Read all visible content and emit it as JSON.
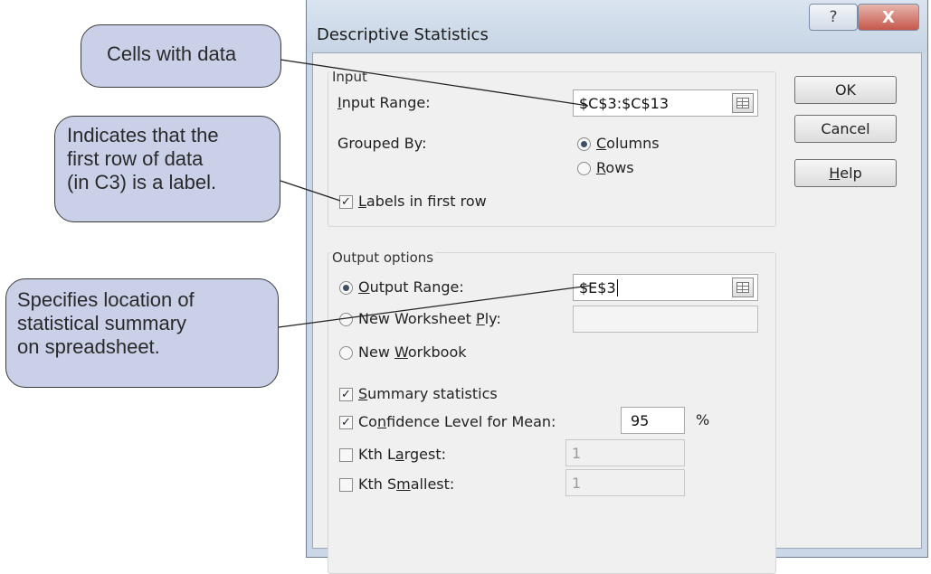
{
  "callouts": {
    "cells": "Cells with data",
    "labels": [
      "Indicates that the",
      "first row of data",
      "(in C3) is a label."
    ],
    "location": [
      "Specifies location of",
      "statistical summary",
      "on spreadsheet."
    ]
  },
  "dialog": {
    "title": "Descriptive Statistics",
    "help_glyph": "?",
    "close_glyph": "X",
    "input": {
      "group_label": "Input",
      "range_label_key": "I",
      "range_label_rest": "nput Range:",
      "range_value": "$C$3:$C$13",
      "grouped_by_label": "Grouped By:",
      "columns_key": "C",
      "columns_rest": "olumns",
      "rows_key": "R",
      "rows_rest": "ows",
      "labels_key": "L",
      "labels_rest": "abels in first row"
    },
    "output": {
      "group_label": "Output options",
      "range_key": "O",
      "range_rest": "utput Range:",
      "range_value": "$E$3",
      "worksheet_pre": "New Worksheet ",
      "worksheet_key": "P",
      "worksheet_rest": "ly:",
      "workbook_pre": "New ",
      "workbook_key": "W",
      "workbook_rest": "orkbook",
      "summary_key": "S",
      "summary_rest": "ummary statistics",
      "confidence_pre": "Co",
      "confidence_key": "n",
      "confidence_rest": "fidence Level for Mean:",
      "confidence_value": "95",
      "percent": "%",
      "kth_largest_pre": "Kth L",
      "kth_largest_key": "a",
      "kth_largest_rest": "rgest:",
      "kth_largest_value": "1",
      "kth_smallest_pre": "Kth S",
      "kth_smallest_key": "m",
      "kth_smallest_rest": "allest:",
      "kth_smallest_value": "1"
    },
    "buttons": {
      "ok": "OK",
      "cancel": "Cancel",
      "help_key": "H",
      "help_rest": "elp"
    }
  },
  "icons": {
    "help": "question-icon",
    "close": "close-icon",
    "range_picker": "collapse-dialog-icon"
  }
}
